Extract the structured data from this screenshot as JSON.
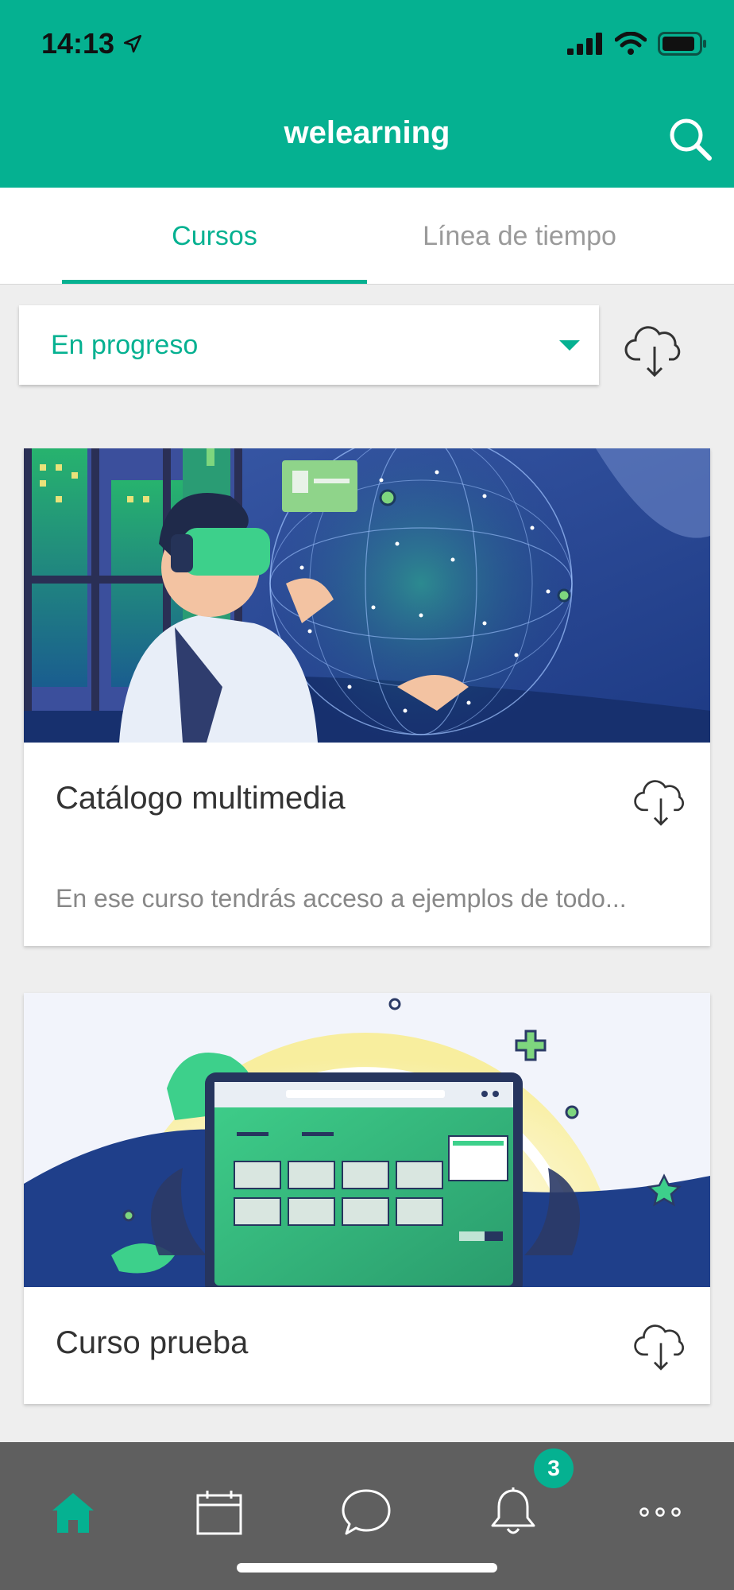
{
  "status_bar": {
    "time": "14:13"
  },
  "header": {
    "title": "welearning"
  },
  "tabs": [
    {
      "label": "Cursos",
      "active": true
    },
    {
      "label": "Línea de tiempo",
      "active": false
    }
  ],
  "filter": {
    "selected": "En progreso"
  },
  "courses": [
    {
      "title": "Catálogo multimedia",
      "description": "En ese curso tendrás acceso a ejemplos de todo..."
    },
    {
      "title": "Curso prueba",
      "description": ""
    }
  ],
  "bottom_nav": {
    "items": [
      {
        "name": "home",
        "active": true
      },
      {
        "name": "calendar",
        "active": false
      },
      {
        "name": "messages",
        "active": false
      },
      {
        "name": "notifications",
        "active": false,
        "badge": "3"
      },
      {
        "name": "more",
        "active": false
      }
    ]
  },
  "colors": {
    "primary": "#05b191",
    "bottom_bar": "#5f5f5f",
    "background": "#eeeeee"
  }
}
